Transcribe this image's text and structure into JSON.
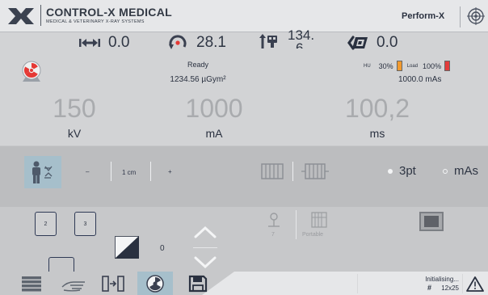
{
  "header": {
    "brand": "CONTROL-X MEDICAL",
    "brand_sub": "MEDICAL & VETERINARY X-RAY SYSTEMS",
    "product": "Perform-X",
    "icons": [
      "logo-mark",
      "target-icon"
    ]
  },
  "stats": {
    "width": "0.0",
    "rotation": "28.1",
    "height_line1": "134.",
    "height_line2": "6",
    "tilt": "0.0"
  },
  "status": {
    "ready": "Ready",
    "dose": "1234.56 µGym²",
    "hu_label": "HU",
    "hu_value": "30%",
    "load_label": "Load",
    "load_value": "100%",
    "mas_total": "1000.0 mAs",
    "colors": {
      "hu_bar": "#f29a2e",
      "load_bar": "#e23b3b",
      "radiation": "#e53935"
    }
  },
  "exposure": {
    "kv_value": "150",
    "kv_unit": "kV",
    "ma_value": "1000",
    "ma_unit": "mA",
    "ms_value": "100,2",
    "ms_unit": "ms"
  },
  "controls": {
    "minus": "–",
    "step": "1 cm",
    "plus": "+",
    "mode_3pt": "3pt",
    "mode_mas": "mAs",
    "selected_mode": "3pt"
  },
  "lower": {
    "card_a": "2",
    "card_b": "3",
    "density_value": "0",
    "detector_number": "7",
    "portable_label": "Portable"
  },
  "footer": {
    "status": "Initialising...",
    "grid_size": "12x25",
    "accent": "#a6bfcb"
  }
}
